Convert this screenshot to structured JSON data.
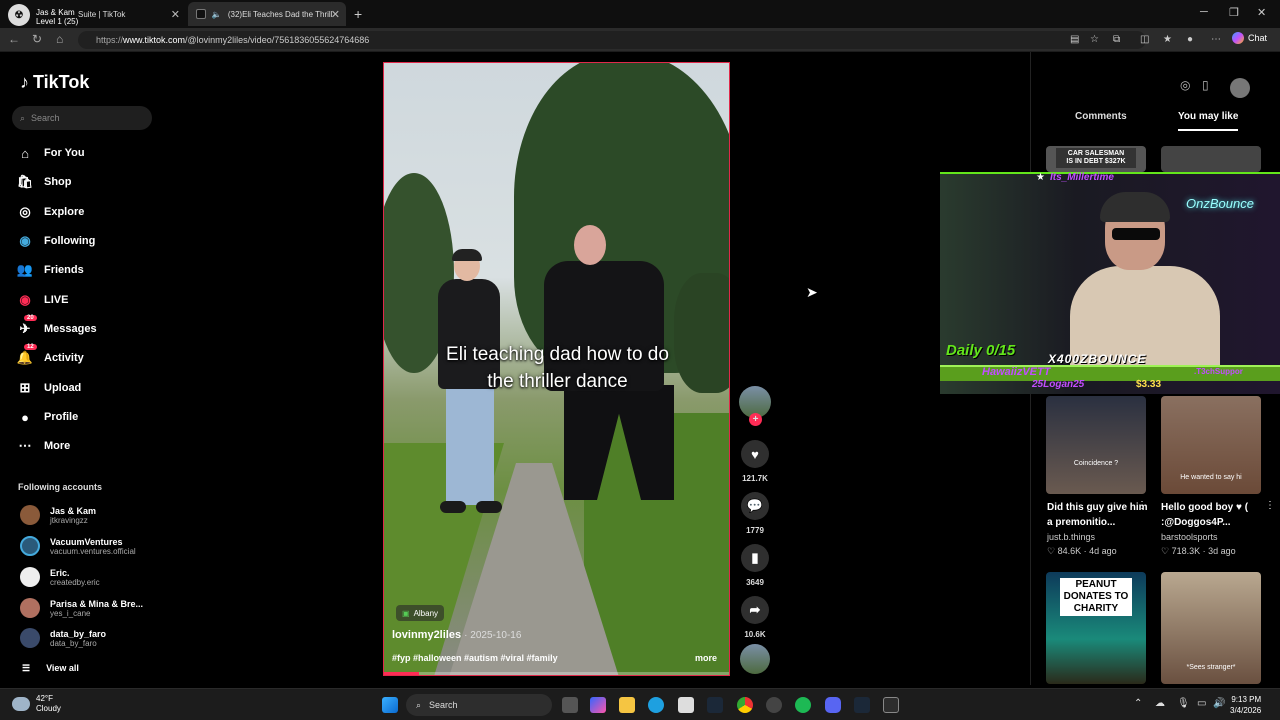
{
  "browser": {
    "overlay_title": "Level 1",
    "overlay_count": "(25)",
    "overlay_name": "Jas & Kam",
    "tab1_title": "Suite | TikTok",
    "tab2_title": "(32)Eli Teaches Dad the Thrill",
    "url_prefix": "https://",
    "url_host": "www.tiktok.com",
    "url_path": "/@lovinmy2liles/video/7561836055624764686",
    "chat_label": "Chat"
  },
  "sidebar": {
    "logo": "TikTok",
    "search_placeholder": "Search",
    "nav": [
      {
        "label": "For You",
        "icon": "home-icon"
      },
      {
        "label": "Shop",
        "icon": "shop-icon"
      },
      {
        "label": "Explore",
        "icon": "compass-icon"
      },
      {
        "label": "Following",
        "icon": "following-icon"
      },
      {
        "label": "Friends",
        "icon": "friends-icon"
      },
      {
        "label": "LIVE",
        "icon": "live-icon"
      },
      {
        "label": "Messages",
        "icon": "messages-icon",
        "badge": "20"
      },
      {
        "label": "Activity",
        "icon": "activity-icon",
        "badge": "12"
      },
      {
        "label": "Upload",
        "icon": "upload-icon"
      },
      {
        "label": "Profile",
        "icon": "profile-icon"
      },
      {
        "label": "More",
        "icon": "more-icon"
      }
    ],
    "following_header": "Following accounts",
    "accounts": [
      {
        "name": "Jas & Kam",
        "handle": "jtkravingzz"
      },
      {
        "name": "VacuumVentures",
        "handle": "vacuum.ventures.official"
      },
      {
        "name": "Eric.",
        "handle": "createdby.eric"
      },
      {
        "name": "Parisa & Mina & Bre...",
        "handle": "yes_i_cane"
      },
      {
        "name": "data_by_faro",
        "handle": "data_by_faro"
      }
    ],
    "view_all": "View all"
  },
  "video": {
    "caption_line1": "Eli teaching dad how to do",
    "caption_line2": "the thriller dance",
    "location": "Albany",
    "author": "lovinmy2liles",
    "date": "· 2025-10-16",
    "tags": "#fyp #halloween #autism #viral #family",
    "more": "more",
    "progress": 0.1
  },
  "actions": {
    "likes": "121.7K",
    "comments": "1779",
    "saves": "3649",
    "shares": "10.6K"
  },
  "right_panel": {
    "tab_comments": "Comments",
    "tab_you_may_like": "You may like",
    "thumb1_text": "CAR SALESMAN IS IN DEBT $327K",
    "cards": [
      {
        "thumb_caption": "Coincidence ?",
        "title": "Did this guy give him a premonitio...",
        "author": "just.b.things",
        "stats": "♡ 84.6K · 4d ago"
      },
      {
        "thumb_caption": "He wanted to say hi",
        "title": "Hello good boy ♥ ( :@Doggos4P...",
        "author": "barstoolsports",
        "stats": "♡ 718.3K · 3d ago"
      }
    ],
    "thumb_peanut": "PEANUT DONATES TO CHARITY",
    "thumb_woman_caption": "*Sees stranger*"
  },
  "stream_overlay": {
    "top_user": "Its_Millertime",
    "neon_sign": "OnzBounce",
    "daily": "Daily 0/15",
    "streamer": "X400ZBOUNCE",
    "donor1": "HawaiizVETT",
    "donor2": "25Logan25",
    "amount": "$3.33",
    "support": ".T3chSuppor"
  },
  "taskbar": {
    "temp": "42°F",
    "weather": "Cloudy",
    "search": "Search",
    "time": "9:13 PM",
    "date": "3/4/2026"
  }
}
